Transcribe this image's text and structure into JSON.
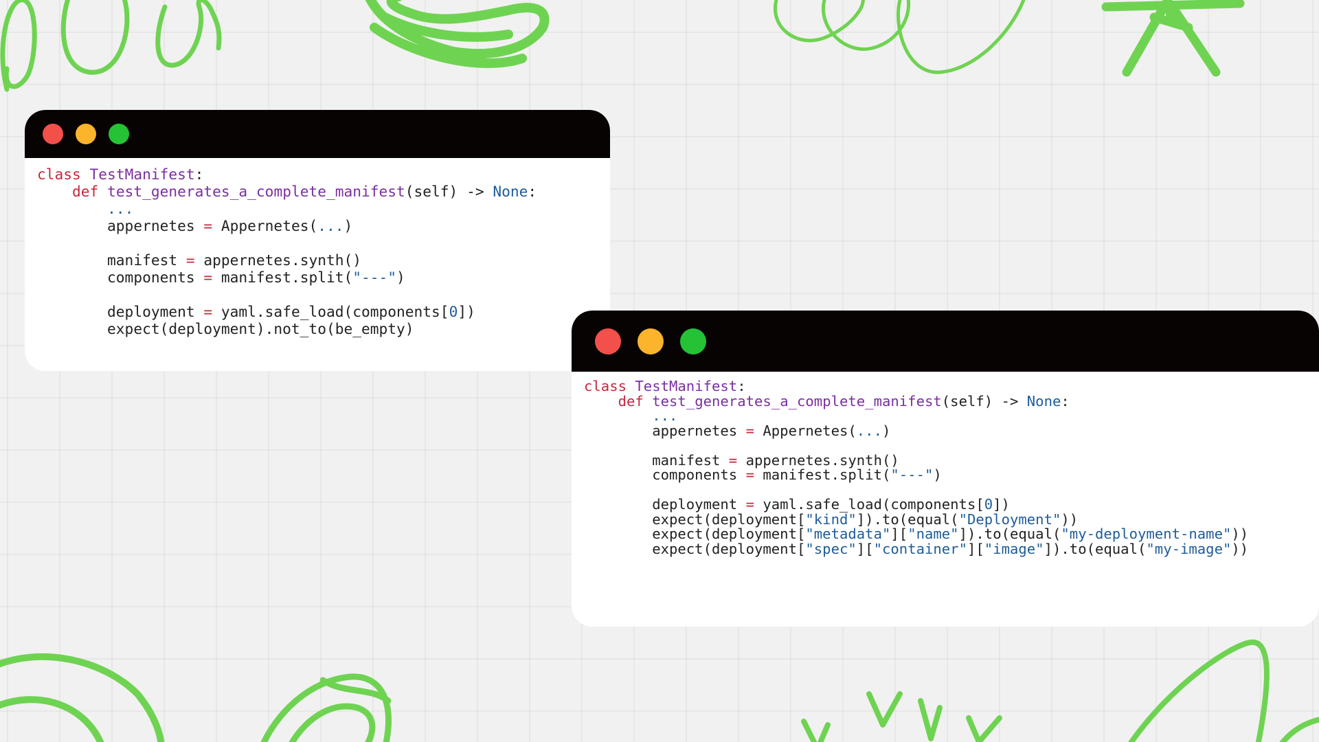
{
  "theme": {
    "background": "#f1f1f1",
    "accent_doodle": "#6fd352",
    "titlebar": "#070303",
    "editor_bg": "#ffffff"
  },
  "window_controls": {
    "close": {
      "icon": "close-dot-icon",
      "color": "#f34f4b"
    },
    "minimize": {
      "icon": "minimize-dot-icon",
      "color": "#fbb42c"
    },
    "maximize": {
      "icon": "maximize-dot-icon",
      "color": "#25c236"
    }
  },
  "windows": [
    {
      "lines": [
        [
          [
            "kw",
            "class"
          ],
          [
            "p",
            " "
          ],
          [
            "n",
            "TestManifest"
          ],
          [
            "p",
            ":"
          ]
        ],
        [
          [
            "p",
            "    "
          ],
          [
            "kw",
            "def"
          ],
          [
            "p",
            " "
          ],
          [
            "n",
            "test_generates_a_complete_manifest"
          ],
          [
            "p",
            "(self) -> "
          ],
          [
            "c",
            "None"
          ],
          [
            "p",
            ":"
          ]
        ],
        [
          [
            "p",
            "        "
          ],
          [
            "c",
            "..."
          ]
        ],
        [
          [
            "p",
            "        appernetes "
          ],
          [
            "o",
            "="
          ],
          [
            "p",
            " Appernetes("
          ],
          [
            "c",
            "..."
          ],
          [
            "p",
            ")"
          ]
        ],
        [],
        [
          [
            "p",
            "        manifest "
          ],
          [
            "o",
            "="
          ],
          [
            "p",
            " appernetes.synth()"
          ]
        ],
        [
          [
            "p",
            "        components "
          ],
          [
            "o",
            "="
          ],
          [
            "p",
            " manifest.split("
          ],
          [
            "s",
            "\"---\""
          ],
          [
            "p",
            ")"
          ]
        ],
        [],
        [
          [
            "p",
            "        deployment "
          ],
          [
            "o",
            "="
          ],
          [
            "p",
            " yaml.safe_load(components["
          ],
          [
            "num",
            "0"
          ],
          [
            "p",
            "])"
          ]
        ],
        [
          [
            "p",
            "        expect(deployment).not_to(be_empty)"
          ]
        ]
      ]
    },
    {
      "lines": [
        [
          [
            "kw",
            "class"
          ],
          [
            "p",
            " "
          ],
          [
            "n",
            "TestManifest"
          ],
          [
            "p",
            ":"
          ]
        ],
        [
          [
            "p",
            "    "
          ],
          [
            "kw",
            "def"
          ],
          [
            "p",
            " "
          ],
          [
            "n",
            "test_generates_a_complete_manifest"
          ],
          [
            "p",
            "(self) -> "
          ],
          [
            "c",
            "None"
          ],
          [
            "p",
            ":"
          ]
        ],
        [
          [
            "p",
            "        "
          ],
          [
            "c",
            "..."
          ]
        ],
        [
          [
            "p",
            "        appernetes "
          ],
          [
            "o",
            "="
          ],
          [
            "p",
            " Appernetes("
          ],
          [
            "c",
            "..."
          ],
          [
            "p",
            ")"
          ]
        ],
        [],
        [
          [
            "p",
            "        manifest "
          ],
          [
            "o",
            "="
          ],
          [
            "p",
            " appernetes.synth()"
          ]
        ],
        [
          [
            "p",
            "        components "
          ],
          [
            "o",
            "="
          ],
          [
            "p",
            " manifest.split("
          ],
          [
            "s",
            "\"---\""
          ],
          [
            "p",
            ")"
          ]
        ],
        [],
        [
          [
            "p",
            "        deployment "
          ],
          [
            "o",
            "="
          ],
          [
            "p",
            " yaml.safe_load(components["
          ],
          [
            "num",
            "0"
          ],
          [
            "p",
            "])"
          ]
        ],
        [
          [
            "p",
            "        expect(deployment["
          ],
          [
            "s",
            "\"kind\""
          ],
          [
            "p",
            "]).to(equal("
          ],
          [
            "s",
            "\"Deployment\""
          ],
          [
            "p",
            "))"
          ]
        ],
        [
          [
            "p",
            "        expect(deployment["
          ],
          [
            "s",
            "\"metadata\""
          ],
          [
            "p",
            "]["
          ],
          [
            "s",
            "\"name\""
          ],
          [
            "p",
            "]).to(equal("
          ],
          [
            "s",
            "\"my-deployment-name\""
          ],
          [
            "p",
            "))"
          ]
        ],
        [
          [
            "p",
            "        expect(deployment["
          ],
          [
            "s",
            "\"spec\""
          ],
          [
            "p",
            "]["
          ],
          [
            "s",
            "\"container\""
          ],
          [
            "p",
            "]["
          ],
          [
            "s",
            "\"image\""
          ],
          [
            "p",
            "]).to(equal("
          ],
          [
            "s",
            "\"my-image\""
          ],
          [
            "p",
            "))"
          ]
        ]
      ]
    }
  ]
}
